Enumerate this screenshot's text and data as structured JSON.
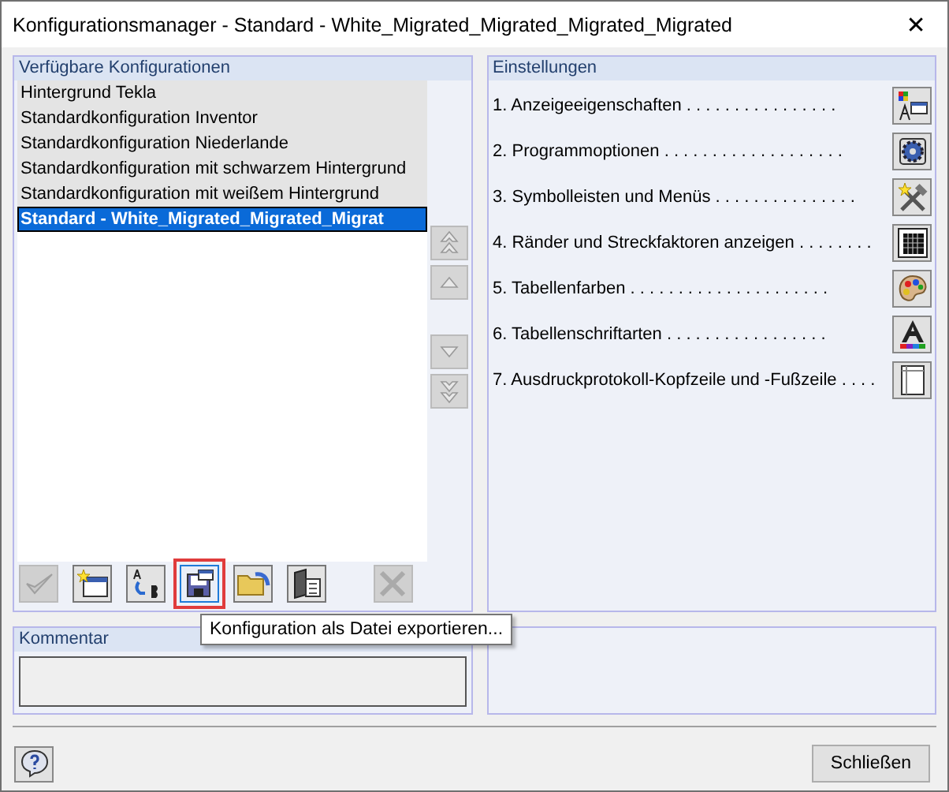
{
  "window": {
    "title": "Konfigurationsmanager - Standard - White_Migrated_Migrated_Migrated_Migrated",
    "close": "✕"
  },
  "configurations": {
    "title": "Verfügbare Konfigurationen",
    "items": [
      {
        "label": "Hintergrund Tekla",
        "selected": false
      },
      {
        "label": "Standardkonfiguration Inventor",
        "selected": false
      },
      {
        "label": "Standardkonfiguration Niederlande",
        "selected": false
      },
      {
        "label": "Standardkonfiguration mit schwarzem Hintergrund",
        "selected": false
      },
      {
        "label": "Standardkonfiguration mit weißem Hintergrund",
        "selected": false
      },
      {
        "label": "Standard - White_Migrated_Migrated_Migrat",
        "selected": true
      }
    ],
    "move_buttons": [
      {
        "kind": "top",
        "disabled": true
      },
      {
        "kind": "up",
        "disabled": true
      },
      {
        "kind": "down",
        "disabled": true
      },
      {
        "kind": "bottom",
        "disabled": true
      }
    ],
    "toolbar": [
      {
        "kind": "apply",
        "disabled": true,
        "highlighted": false
      },
      {
        "kind": "new",
        "disabled": false,
        "highlighted": false
      },
      {
        "kind": "rename",
        "disabled": false,
        "highlighted": false
      },
      {
        "kind": "export",
        "disabled": false,
        "highlighted": true
      },
      {
        "kind": "import",
        "disabled": false,
        "highlighted": false
      },
      {
        "kind": "copy",
        "disabled": false,
        "highlighted": false
      },
      {
        "kind": "delete",
        "disabled": true,
        "highlighted": false
      }
    ]
  },
  "tooltip": "Konfiguration als Datei exportieren...",
  "settings": {
    "title": "Einstellungen",
    "items": [
      {
        "label": "1. Anzeigeeigenschaften . . . . . . . . . . . . . . . .",
        "kind": "display"
      },
      {
        "label": "2. Programmoptionen . . . . . . . . . . . . . . . . . . .",
        "kind": "options"
      },
      {
        "label": "3. Symbolleisten und Menüs . . . . . . . . . . . . . . .",
        "kind": "toolbars"
      },
      {
        "label": "4. Ränder und Streckfaktoren anzeigen . . . . . . . .",
        "kind": "margins"
      },
      {
        "label": "5. Tabellenfarben . . . . . . . . . . . . . . . . . . . . .",
        "kind": "colors"
      },
      {
        "label": "6. Tabellenschriftarten . . . . . . . . . . . . . . . . .",
        "kind": "fonts"
      },
      {
        "label": "7. Ausdruckprotokoll-Kopfzeile und -Fußzeile . . . .",
        "kind": "header"
      }
    ]
  },
  "comment": {
    "title": "Kommentar"
  },
  "footer": {
    "close_button": "Schließen"
  }
}
